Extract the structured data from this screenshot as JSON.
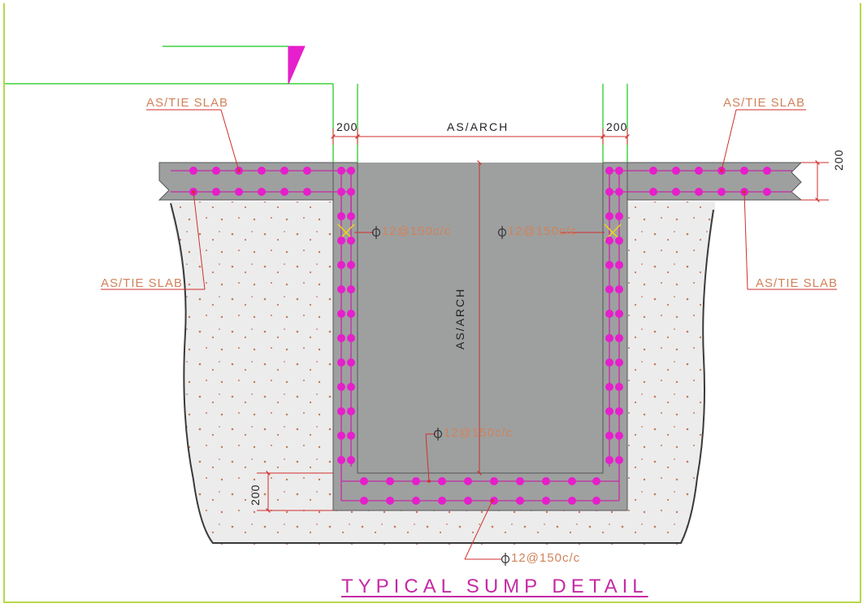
{
  "title": "TYPICAL  SUMP  DETAIL",
  "dims": {
    "wall_left": "200",
    "wall_right": "200",
    "span": "AS/ARCH",
    "depth": "AS/ARCH",
    "slab_thk": "200",
    "base_thk": "200"
  },
  "callouts": {
    "tie_tl": "AS/TIE  SLAB",
    "tie_tr": "AS/TIE  SLAB",
    "tie_bl": "AS/TIE  SLAB",
    "tie_br": "AS/TIE  SLAB"
  },
  "rebar": {
    "r1": "12@150c/c",
    "r2": "12@150c/c",
    "r3": "12@150c/c",
    "r4": "12@150c/c"
  },
  "colors": {
    "concrete": "#9ea0a0",
    "fill": "#ececec",
    "rebar_dot": "#e61ecb",
    "rebar_line": "#c52aa5",
    "leader": "#d22d2d",
    "text_orange": "#d1825a",
    "green": "#18c818",
    "yellow": "#f3d51a"
  }
}
